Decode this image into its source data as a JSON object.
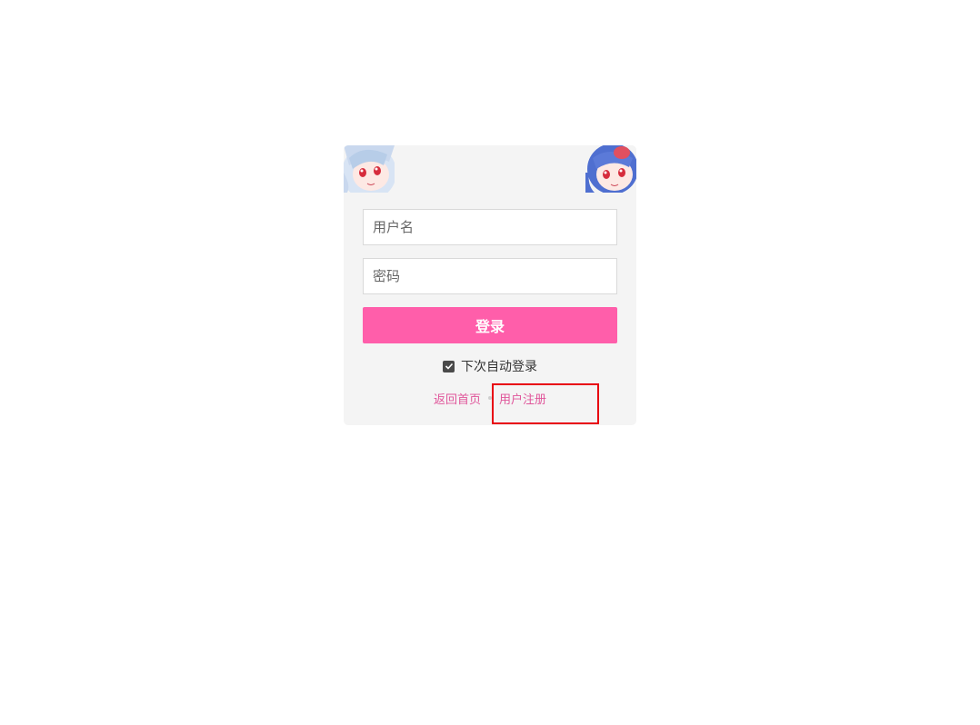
{
  "login": {
    "username_placeholder": "用户名",
    "password_placeholder": "密码",
    "submit_label": "登录",
    "remember_label": "下次自动登录",
    "remember_checked": true
  },
  "links": {
    "home_label": "返回首页",
    "register_label": "用户注册"
  },
  "colors": {
    "accent": "#ff5eaa",
    "link": "#e0559a",
    "card_bg": "#f4f4f4",
    "highlight": "#e8000f"
  },
  "icons": {
    "left_avatar": "anime-girl-avatar-icon",
    "right_avatar": "anime-girl-avatar-icon",
    "checkbox": "checkmark-icon"
  }
}
